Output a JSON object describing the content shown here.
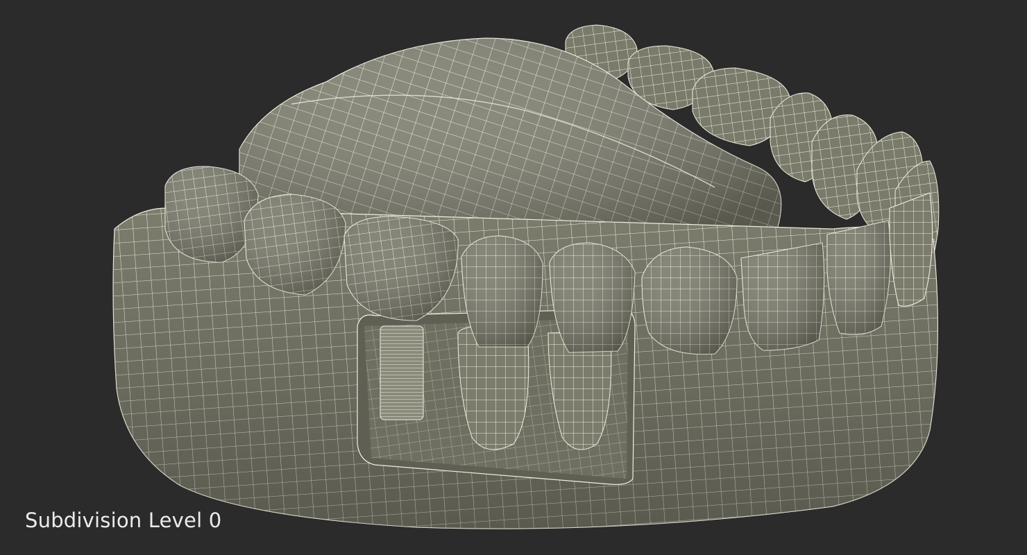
{
  "viewport": {
    "background_color": "#2b2b2b",
    "model_fill_color": "#7d7d6e",
    "model_shadow_color": "#55554a",
    "wire_color": "#f1efe2"
  },
  "model": {
    "subject": "lower dental model with implant wireframe",
    "icon": "dental-model-icon"
  },
  "caption": {
    "label": "Subdivision Level 0"
  }
}
